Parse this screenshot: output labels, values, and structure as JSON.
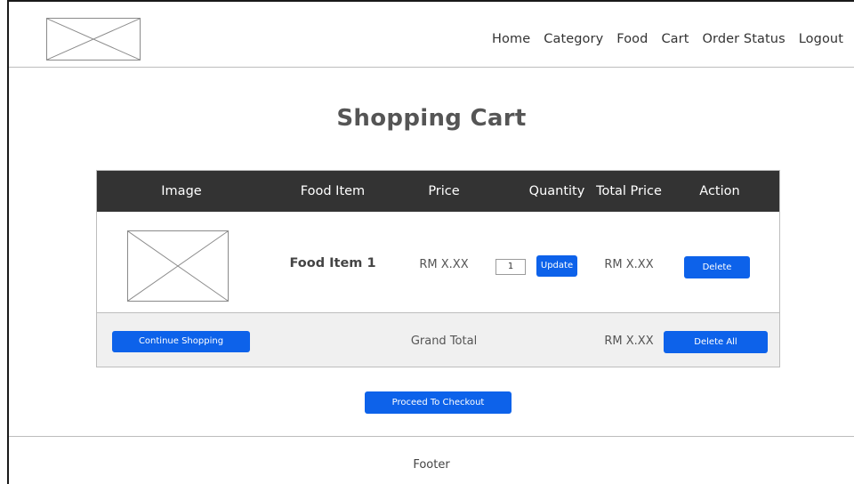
{
  "header": {
    "nav": [
      "Home",
      "Category",
      "Food",
      "Cart",
      "Order Status",
      "Logout"
    ]
  },
  "page": {
    "title": "Shopping Cart"
  },
  "cart": {
    "columns": [
      "Image",
      "Food Item",
      "Price",
      "Quantity",
      "Total Price",
      "Action"
    ],
    "rows": [
      {
        "food_item": "Food Item 1",
        "price": "RM X.XX",
        "quantity": "1",
        "update_label": "Update",
        "total_price": "RM X.XX",
        "delete_label": "Delete"
      }
    ],
    "footer": {
      "continue_label": "Continue Shopping",
      "grand_total_label": "Grand Total",
      "grand_total_value": "RM X.XX",
      "delete_all_label": "Delete All"
    }
  },
  "checkout": {
    "label": "Proceed To Checkout"
  },
  "footer": {
    "text": "Footer"
  },
  "colors": {
    "accent": "#0d62ea",
    "table_header": "#333333",
    "footer_row": "#f0f0f0"
  }
}
